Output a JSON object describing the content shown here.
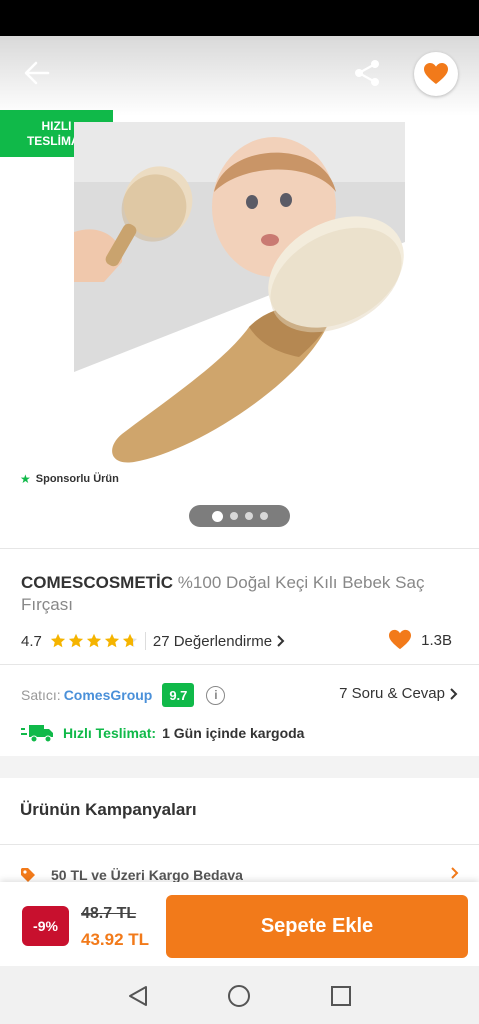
{
  "header": {
    "back_icon": "arrow-left-icon",
    "share_icon": "share-icon",
    "favorite_icon": "heart-icon"
  },
  "badge": {
    "line1": "HIZLI",
    "line2": "TESLİMAT",
    "color": "#10b949"
  },
  "image": {
    "sponsored_label": "Sponsorlu Ürün",
    "page_count": 4,
    "active_page": 1
  },
  "product": {
    "brand": "COMESCOSMETİC",
    "name": "%100 Doğal Keçi Kılı Bebek Saç Fırçası",
    "rating": "4.7",
    "stars": 4.7,
    "reviews_label": "27 Değerlendirme",
    "likes": "1.3B"
  },
  "seller": {
    "label": "Satıcı:",
    "name": "ComesGroup",
    "score": "9.7",
    "qa_label": "7 Soru & Cevap"
  },
  "delivery": {
    "label": "Hızlı Teslimat:",
    "text": "1 Gün içinde kargoda"
  },
  "campaigns": {
    "title": "Ürünün Kampanyaları",
    "items": [
      {
        "label": "50 TL ve Üzeri Kargo Bedava",
        "icon": "tag-icon"
      }
    ]
  },
  "purchase": {
    "discount": "-9%",
    "old_price": "48.7 TL",
    "new_price": "43.92 TL",
    "add_to_cart": "Sepete Ekle"
  },
  "colors": {
    "accent": "#f27a1a",
    "green": "#10b949",
    "discount_red": "#c8102e",
    "link_blue": "#4a90d9"
  }
}
